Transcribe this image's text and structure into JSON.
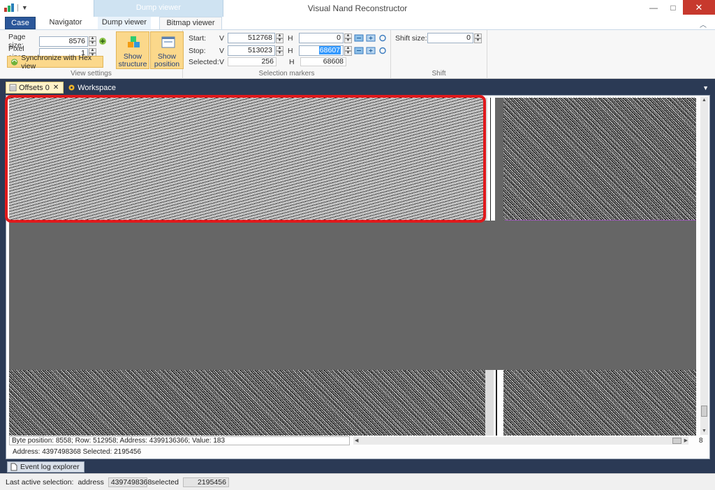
{
  "app": {
    "title": "Visual Nand Reconstructor"
  },
  "context_tab_header": "Dump viewer",
  "tabs": {
    "case": "Case",
    "navigator": "Navigator",
    "dump_viewer": "Dump viewer",
    "bitmap_viewer": "Bitmap viewer"
  },
  "view_settings": {
    "page_size_label": "Page size:",
    "page_size": "8576",
    "pixel_size_label": "Pixel size:",
    "pixel_size": "1",
    "sync_label": "Synchronize with Hex view",
    "show_structure": "Show structure",
    "show_position": "Show position",
    "group_label": "View settings"
  },
  "selection": {
    "start_label": "Start:",
    "stop_label": "Stop:",
    "selected_label": "Selected:",
    "v_label": "V",
    "h_label": "H",
    "start_v": "512768",
    "start_h": "0",
    "stop_v": "513023",
    "stop_h": "68607",
    "selected_v": "256",
    "selected_h": "68608",
    "group_label": "Selection markers"
  },
  "shift": {
    "label": "Shift size:",
    "value": "0",
    "group_label": "Shift"
  },
  "doc_tabs": {
    "offsets": "Offsets 0",
    "workspace": "Workspace"
  },
  "status_line": "Byte position: 8558; Row: 512958; Address: 4399136366; Value: 183",
  "page_number": "8",
  "address_line": "Address:   4397498368   Selected:   2195456",
  "bottom_tab": "Event log explorer",
  "statusbar": {
    "last_label": "Last active selection:",
    "address_label": "address",
    "address_value": "4397498368",
    "selected_label": "selected",
    "selected_value": "2195456"
  },
  "colors": {
    "accent": "#2b579a",
    "highlight": "#e0191c",
    "ribbon_button": "#fbd88b"
  }
}
